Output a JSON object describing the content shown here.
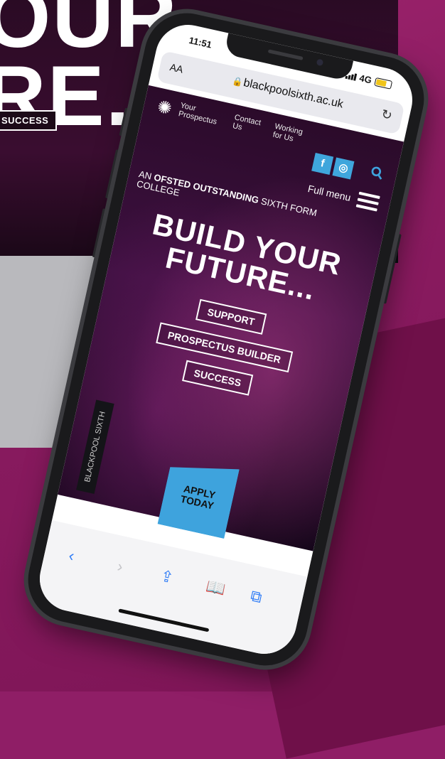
{
  "background": {
    "headline_line1": "OUR",
    "headline_line2": "RE...",
    "success_label": "SUCCESS"
  },
  "phone": {
    "status": {
      "time": "11:51",
      "network": "4G"
    },
    "browser": {
      "text_size_label": "AA",
      "url": "blackpoolsixth.ac.uk"
    },
    "site": {
      "nav": [
        {
          "label": "Your Prospectus"
        },
        {
          "label": "Contact Us"
        },
        {
          "label": "Working for Us"
        }
      ],
      "full_menu_label": "Full menu",
      "ofsted_prefix": "AN",
      "ofsted_strong": "OFSTED OUTSTANDING",
      "ofsted_suffix": "SIXTH FORM COLLEGE",
      "headline_line1": "BUILD YOUR",
      "headline_line2": "FUTURE...",
      "buttons": [
        {
          "label": "SUPPORT"
        },
        {
          "label": "PROSPECTUS BUILDER"
        },
        {
          "label": "SUCCESS"
        }
      ],
      "vertical_label": "BLACKPOOL SIXTH",
      "apply_line1": "APPLY",
      "apply_line2": "TODAY"
    },
    "colors": {
      "accent": "#3ea3dd",
      "background": "#8f1e66"
    }
  }
}
